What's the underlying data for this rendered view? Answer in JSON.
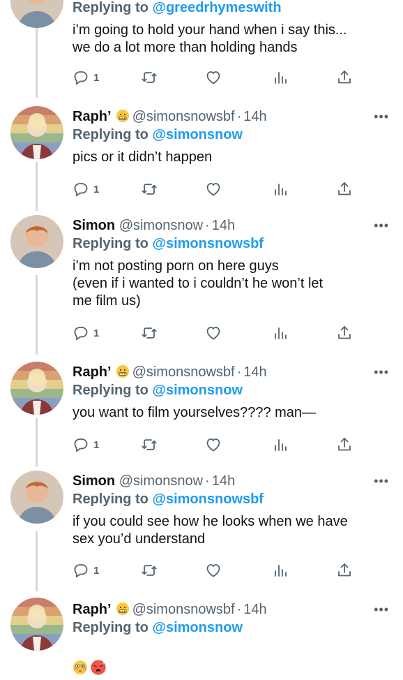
{
  "thread": {
    "top_fragment": {
      "replying_label": "Replying to",
      "replying_handle": "@greedrhymeswith",
      "text": "i’m going to hold your hand when i say this...\nwe do a lot more than holding hands",
      "reply_count": "1"
    },
    "tweets": [
      {
        "name": "Raph’",
        "handle": "@simonsnowsbf",
        "sep": "·",
        "time": "14h",
        "more": "•••",
        "replying_label": "Replying to",
        "replying_handle": "@simonsnow",
        "text": "pics or it didn’t happen",
        "reply_count": "1"
      },
      {
        "name": "Simon",
        "handle": "@simonsnow",
        "sep": "·",
        "time": "14h",
        "more": "•••",
        "replying_label": "Replying to",
        "replying_handle": "@simonsnowsbf",
        "text": "i’m not posting porn on here guys\n(even if i wanted to i couldn’t he won’t let\nme film us)",
        "reply_count": "1"
      },
      {
        "name": "Raph’",
        "handle": "@simonsnowsbf",
        "sep": "·",
        "time": "14h",
        "more": "•••",
        "replying_label": "Replying to",
        "replying_handle": "@simonsnow",
        "text": "you want to film yourselves???? man—",
        "reply_count": "1"
      },
      {
        "name": "Simon",
        "handle": "@simonsnow",
        "sep": "·",
        "time": "14h",
        "more": "•••",
        "replying_label": "Replying to",
        "replying_handle": "@simonsnowsbf",
        "text": "if you could see how he looks when we have\nsex you’d understand",
        "reply_count": "1"
      },
      {
        "name": "Raph’",
        "handle": "@simonsnowsbf",
        "sep": "·",
        "time": "14h",
        "more": "•••",
        "replying_label": "Replying to",
        "replying_handle": "@simonsnow",
        "text": ""
      }
    ]
  },
  "icons": {
    "reply": "reply-icon",
    "retweet": "retweet-icon",
    "like": "heart-icon",
    "views": "views-icon",
    "share": "share-icon",
    "name_badge": "grimacing-face-emoji",
    "last_tweet_emojis": [
      "flushed-face-emoji",
      "hot-face-emoji"
    ]
  },
  "colors": {
    "accent": "#1d9bf0",
    "secondary_text": "#536471",
    "thread_line": "#cfd9de"
  }
}
